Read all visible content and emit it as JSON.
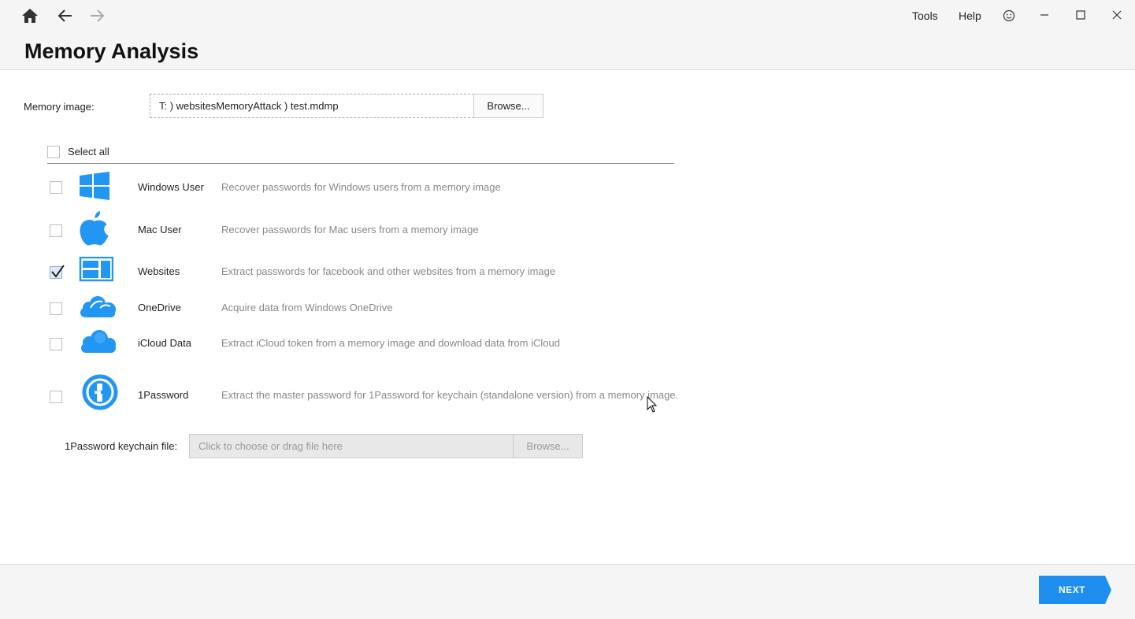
{
  "header": {
    "title": "Memory Analysis",
    "menu": {
      "tools": "Tools",
      "help": "Help"
    }
  },
  "memory_image": {
    "label": "Memory image:",
    "value": "T: ) websitesMemoryAttack ) test.mdmp",
    "browse_label": "Browse..."
  },
  "select_all": {
    "label": "Select all",
    "checked": false
  },
  "items": [
    {
      "name": "Windows User",
      "description": "Recover passwords for Windows users from a memory image",
      "checked": false,
      "icon": "windows-icon"
    },
    {
      "name": "Mac User",
      "description": "Recover passwords for Mac users from a memory image",
      "checked": false,
      "icon": "apple-icon"
    },
    {
      "name": "Websites",
      "description": "Extract passwords for facebook and other websites from a memory image",
      "checked": true,
      "icon": "websites-icon"
    },
    {
      "name": "OneDrive",
      "description": "Acquire data from Windows OneDrive",
      "checked": false,
      "icon": "onedrive-icon"
    },
    {
      "name": "iCloud Data",
      "description": "Extract iCloud token from a memory image and download data from iCloud",
      "checked": false,
      "icon": "icloud-icon"
    },
    {
      "name": "1Password",
      "description": "Extract the master password for 1Password for keychain (standalone version) from a memory image.",
      "checked": false,
      "icon": "1password-icon"
    }
  ],
  "keychain": {
    "label": "1Password keychain file:",
    "placeholder": "Click to choose or drag file here",
    "browse_label": "Browse..."
  },
  "footer": {
    "next_label": "NEXT"
  },
  "colors": {
    "accent": "#1e8ff0",
    "icon_blue": "#2196f3"
  }
}
